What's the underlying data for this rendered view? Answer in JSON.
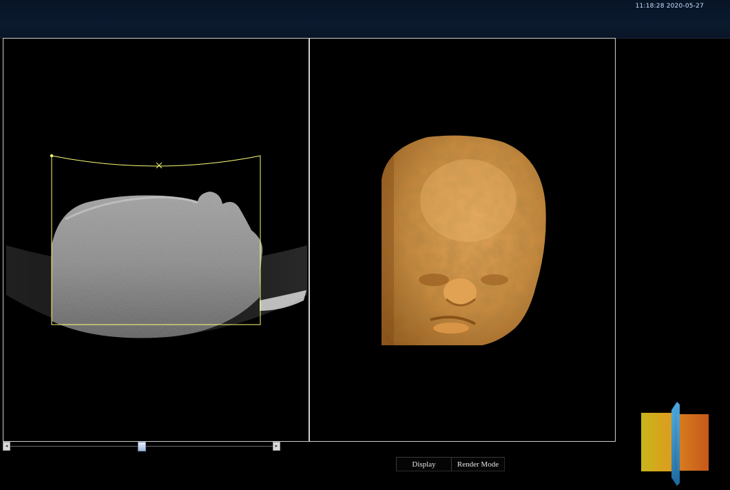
{
  "header": {
    "clock": "11:18:28 2020-05-27"
  },
  "tabs": [
    {
      "label": "Display"
    },
    {
      "label": "Render Mode"
    }
  ],
  "scrollbar": {
    "left_glyph": "◂",
    "right_glyph": "▸",
    "position": 0.5
  },
  "colors": {
    "roi_box": "#ffff7a",
    "skin_tone": "#c78a3c",
    "cube_front": "#d6a21c",
    "cube_right": "#cf6a1c",
    "cube_plane": "#2f8fd0"
  },
  "icons": {
    "roi_center": "x-marker-icon",
    "roi_handle": "roi-handle-icon",
    "orientation": "orientation-cube-icon"
  }
}
